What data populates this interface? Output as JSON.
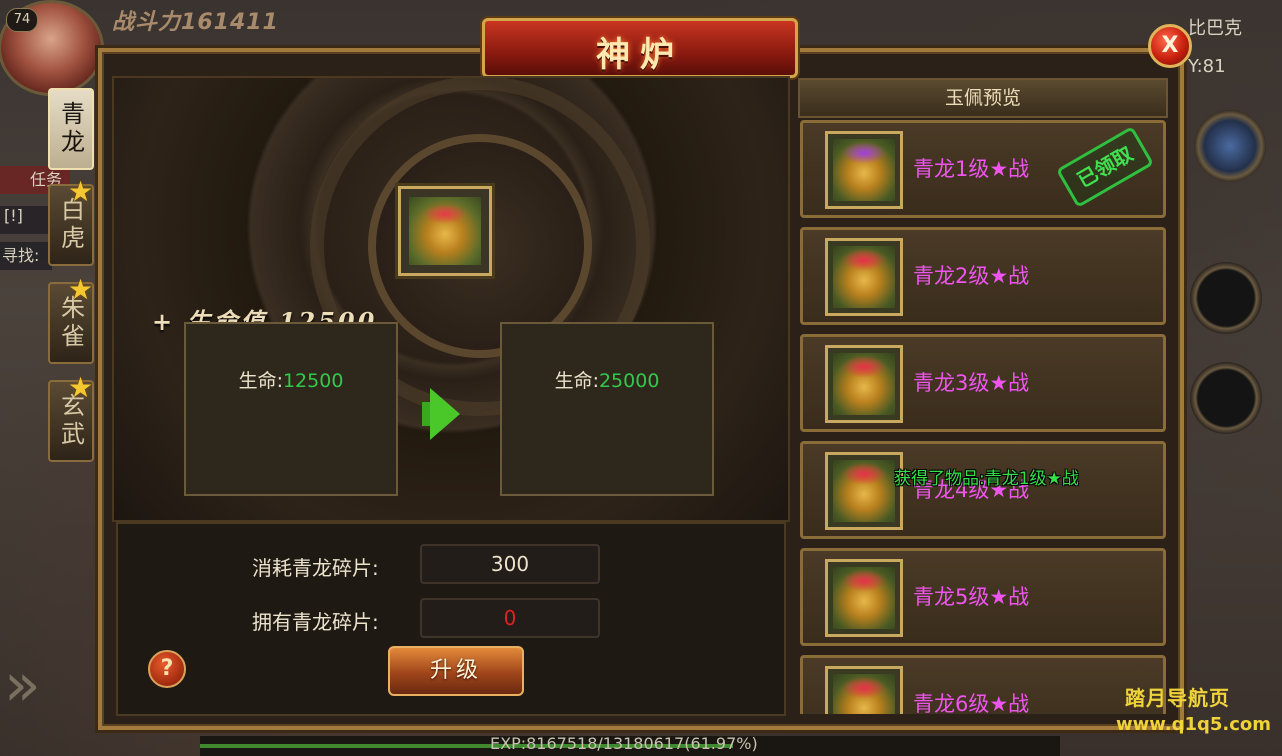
{
  "hud": {
    "level": "74",
    "power_label": "战斗力",
    "power_value": "161411",
    "task_label": "任务",
    "task_line": "[!]",
    "seek_label": "寻找:",
    "map_name": "比巴克",
    "coord_label": "Y:81",
    "exp_text": "EXP:8167518/13180617(61.97%)",
    "exp_fraction": 0.6197,
    "watermark_1": "踏月导航页",
    "watermark_2": "www.q1q5.com",
    "expand_arrow": "»"
  },
  "panel": {
    "title": "神炉",
    "close_label": "X"
  },
  "tabs": [
    {
      "label": "青龙",
      "active": true,
      "star": false
    },
    {
      "label": "白虎",
      "active": false,
      "star": true
    },
    {
      "label": "朱雀",
      "active": false,
      "star": true
    },
    {
      "label": "玄武",
      "active": false,
      "star": true
    }
  ],
  "star_glyph": "★",
  "forge": {
    "bonus_text": "+ 生命值 12500",
    "current": {
      "label": "生命:",
      "value": "12500"
    },
    "next": {
      "label": "生命:",
      "value": "25000"
    }
  },
  "upgrade": {
    "cost_label": "消耗青龙碎片:",
    "cost_value": "300",
    "owned_label": "拥有青龙碎片:",
    "owned_value": "0",
    "help_label": "?",
    "button_label": "升级"
  },
  "preview": {
    "header": "玉佩预览",
    "claimed_label": "已领取",
    "items": [
      {
        "name": "青龙1级★战",
        "claimed": true
      },
      {
        "name": "青龙2级★战",
        "claimed": false
      },
      {
        "name": "青龙3级★战",
        "claimed": false
      },
      {
        "name": "青龙4级★战",
        "claimed": false
      },
      {
        "name": "青龙5级★战",
        "claimed": false
      },
      {
        "name": "青龙6级★战",
        "claimed": false
      }
    ]
  },
  "toast": "获得了物品:青龙1级★战",
  "colors": {
    "stat_green": "#34c84a",
    "owned_red": "#e02020",
    "item_name_magenta": "#ee55ee",
    "panel_gold": "#a27a3c"
  }
}
